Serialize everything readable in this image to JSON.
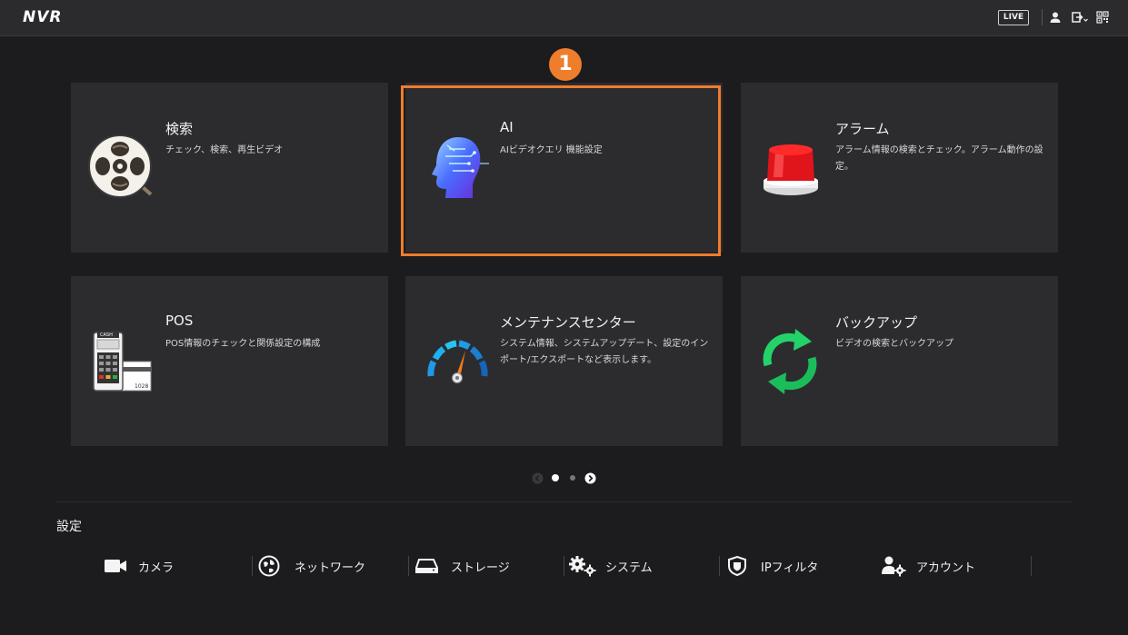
{
  "header": {
    "logo_text": "NVR",
    "live_label": "LIVE",
    "icons": [
      "user-icon",
      "logout-icon",
      "qr-code-icon"
    ]
  },
  "step_marker": "1",
  "tiles": [
    {
      "title": "検索",
      "desc": "チェック、検索、再生ビデオ",
      "icon": "film-reel-search-icon"
    },
    {
      "title": "AI",
      "desc": "AIビデオクエリ 機能設定",
      "icon": "ai-head-icon",
      "highlighted": true
    },
    {
      "title": "アラーム",
      "desc": "アラーム情報の検索とチェック。アラーム動作の設定。",
      "icon": "alarm-siren-icon"
    },
    {
      "title": "POS",
      "desc": "POS情報のチェックと関係設定の構成",
      "icon": "pos-terminal-icon",
      "icon_text_top": "CASH",
      "icon_text_bottom": "1028"
    },
    {
      "title": "メンテナンスセンター",
      "desc": "システム情報、システムアップデート、設定のインポート/エクスポートなど表示します。",
      "icon": "gauge-icon"
    },
    {
      "title": "バックアップ",
      "desc": "ビデオの検索とバックアップ",
      "icon": "sync-arrows-icon"
    }
  ],
  "pagination": {
    "total_pages": 2,
    "current_page": 1
  },
  "settings": {
    "title": "設定",
    "items": [
      {
        "label": "カメラ",
        "icon": "camera-icon"
      },
      {
        "label": "ネットワーク",
        "icon": "network-globe-icon"
      },
      {
        "label": "ストレージ",
        "icon": "storage-drive-icon"
      },
      {
        "label": "システム",
        "icon": "gears-icon"
      },
      {
        "label": "IPフィルタ",
        "icon": "shield-icon"
      },
      {
        "label": "アカウント",
        "icon": "account-gear-icon"
      }
    ]
  },
  "colors": {
    "background": "#1c1c1e",
    "tile": "#2c2c2f",
    "accent_orange": "#ee7d2c"
  }
}
